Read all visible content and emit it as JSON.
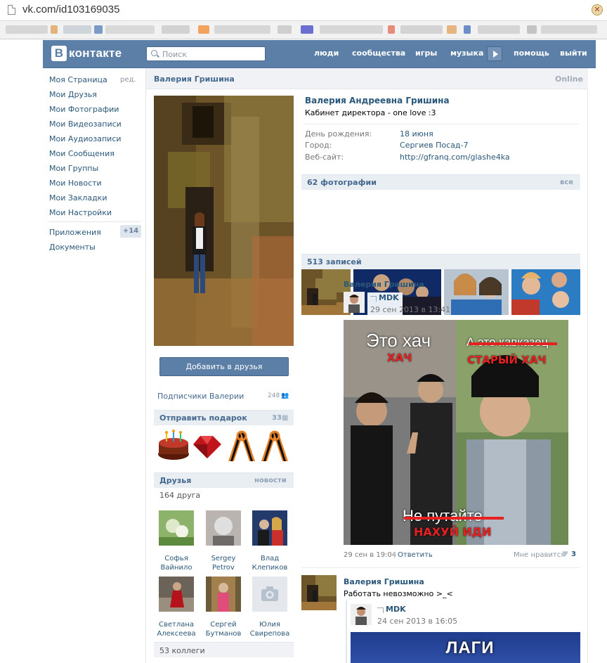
{
  "browser": {
    "url": "vk.com/id103169035"
  },
  "header": {
    "logo_letter": "В",
    "logo_text": "контакте",
    "search_placeholder": "Поиск",
    "nav": [
      "люди",
      "сообщества",
      "игры",
      "музыка",
      "помощь",
      "выйти"
    ]
  },
  "sidebar": {
    "items": [
      "Моя Страница",
      "Мои Друзья",
      "Мои Фотографии",
      "Мои Видеозаписи",
      "Мои Аудиозаписи",
      "Мои Сообщения",
      "Мои Группы",
      "Мои Новости",
      "Мои Закладки",
      "Мои Настройки"
    ],
    "edit_label": "ред.",
    "apps_label": "Приложения",
    "apps_count": "+14",
    "docs_label": "Документы"
  },
  "profile": {
    "topbar_name": "Валерия Гришина",
    "online": "Online",
    "full_name": "Валерия Андреевна Гришина",
    "status": "Кабинет директора - one love :3",
    "fields": [
      {
        "label": "День рождения:",
        "value": "18 июня"
      },
      {
        "label": "Город:",
        "value": "Сергиев Посад-7"
      },
      {
        "label": "Веб-сайт:",
        "value": "http://gfranq.com/glashe4ka"
      }
    ],
    "add_friend": "Добавить в друзья",
    "subscribers_label": "Подписчики Валерии",
    "subscribers_count": "248"
  },
  "gifts": {
    "title": "Отправить подарок",
    "count": "33"
  },
  "friends": {
    "title": "Друзья",
    "news_link": "новости",
    "count_text": "164 друга",
    "list": [
      {
        "first": "Софья",
        "last": "Вайнило"
      },
      {
        "first": "Sergey",
        "last": "Petrov"
      },
      {
        "first": "Влад",
        "last": "Клепиков"
      },
      {
        "first": "Светлана",
        "last": "Алексеева"
      },
      {
        "first": "Сергей",
        "last": "Бутманов"
      },
      {
        "first": "Юлия",
        "last": "Свирепова"
      }
    ],
    "colleagues": "53 коллеги"
  },
  "photos": {
    "title": "62 фотографии",
    "all_link": "все"
  },
  "wall": {
    "title": "513 записей",
    "posts": [
      {
        "author": "Валерия Гришина",
        "repost_from": "MDK",
        "repost_date": "29 сен 2013 в 13:41",
        "meme": {
          "left_top": "Это хач",
          "left_red": "ХАЧ",
          "right_top": "А это кавказец",
          "right_red": "СТАРЫЙ ХАЧ",
          "bottom_top": "Не путайте",
          "bottom_red": "НАХУЙ ИДИ"
        },
        "date": "29 сен в 19:04",
        "reply": "Ответить",
        "likes_label": "Мне нравится",
        "likes_count": "3"
      },
      {
        "author": "Валерия Гришина",
        "text": "Работать невозможно >_<",
        "repost_from": "MDK",
        "repost_date": "24 сен 2013 в 16:05",
        "image_caption": "ЛАГИ"
      }
    ]
  }
}
